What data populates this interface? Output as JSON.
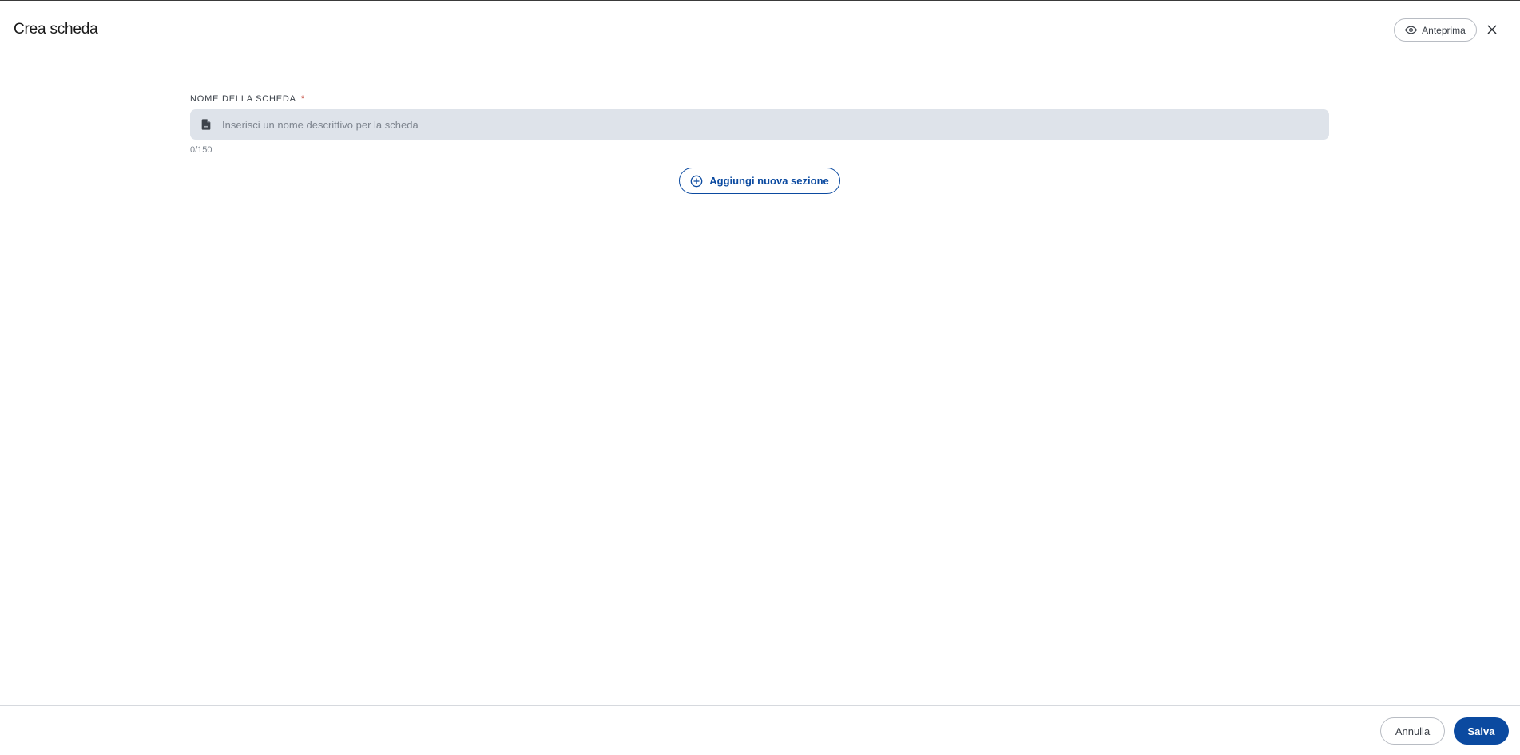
{
  "header": {
    "title": "Crea scheda",
    "preview_label": "Anteprima",
    "preview_icon": "eye-icon",
    "close_icon": "close-icon"
  },
  "form": {
    "name_label": "NOME DELLA SCHEDA",
    "required_mark": "*",
    "name_icon": "document-icon",
    "name_value": "",
    "name_placeholder": "Inserisci un nome descrittivo per la scheda",
    "char_counter": "0/150",
    "add_section_label": "Aggiungi nuova sezione",
    "add_section_icon": "plus-circle-icon"
  },
  "footer": {
    "cancel_label": "Annulla",
    "save_label": "Salva"
  },
  "colors": {
    "primary": "#0b4aa0",
    "input_bg": "#dee3ea",
    "required": "#c0392b",
    "border": "#d6d9de"
  }
}
